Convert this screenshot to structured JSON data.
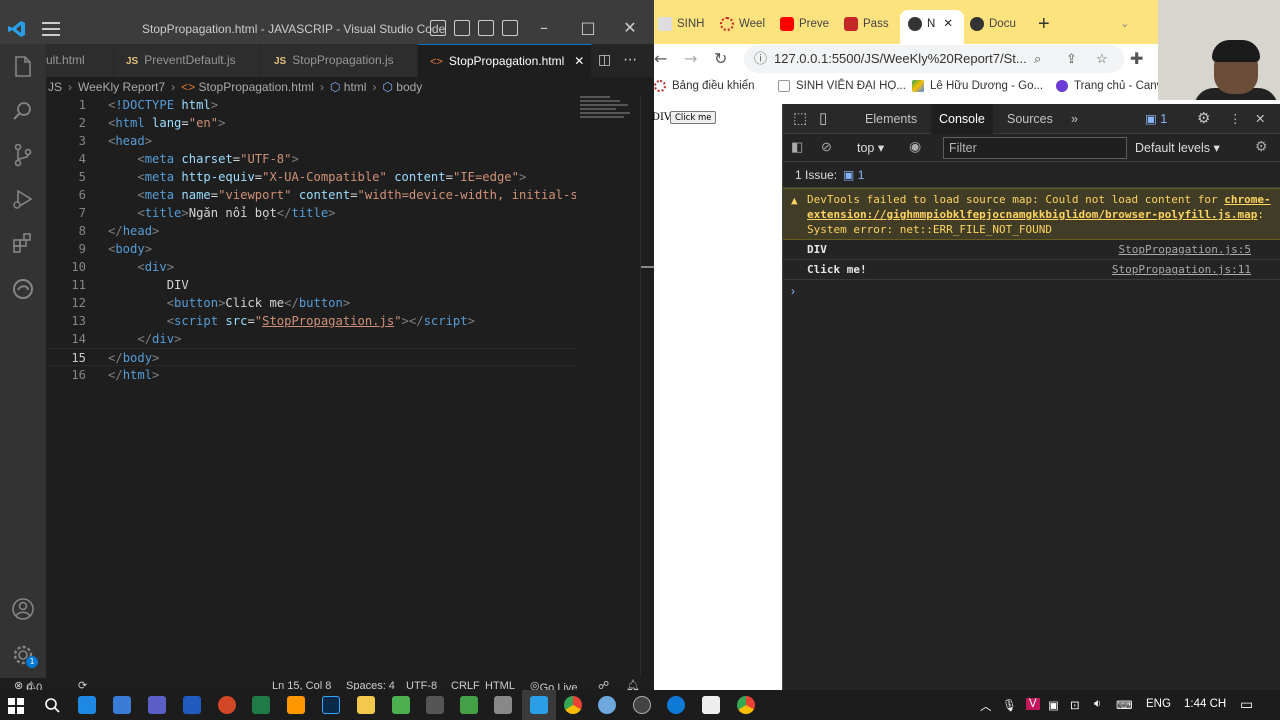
{
  "vscode": {
    "title": "StopPropagation.html - JAVASCRIP - Visual Studio Code",
    "tabs": [
      {
        "label": "ult.html",
        "type": "html"
      },
      {
        "label": "PreventDefault.js",
        "type": "js"
      },
      {
        "label": "StopPropagation.js",
        "type": "js"
      },
      {
        "label": "StopPropagation.html",
        "type": "html",
        "active": true
      }
    ],
    "breadcrumb": [
      "JS",
      "WeeKly Report7",
      "StopPropagation.html",
      "html",
      "body"
    ],
    "code_lines": [
      {
        "n": "1"
      },
      {
        "n": "2"
      },
      {
        "n": "3"
      },
      {
        "n": "4"
      },
      {
        "n": "5"
      },
      {
        "n": "6"
      },
      {
        "n": "7"
      },
      {
        "n": "8"
      },
      {
        "n": "9"
      },
      {
        "n": "10"
      },
      {
        "n": "11"
      },
      {
        "n": "12"
      },
      {
        "n": "13"
      },
      {
        "n": "14"
      },
      {
        "n": "15"
      },
      {
        "n": "16"
      }
    ],
    "code": {
      "doctype": "!DOCTYPE",
      "doctype_val": "html",
      "html_tag": "html",
      "lang_attr": "lang",
      "lang_val": "\"en\"",
      "head_tag": "head",
      "meta_tag": "meta",
      "charset_attr": "charset",
      "charset_val": "\"UTF-8\"",
      "httpequiv_attr": "http-equiv",
      "httpequiv_val": "\"X-UA-Compatible\"",
      "content_attr": "content",
      "content_val": "\"IE=edge\"",
      "name_attr": "name",
      "name_val": "\"viewport\"",
      "content_val2": "\"width=device-width, initial-sc",
      "title_tag": "title",
      "title_text": "Ngăn nổi bọt",
      "body_tag": "body",
      "div_tag": "div",
      "div_text": "DIV",
      "button_tag": "button",
      "button_text": "Click me",
      "script_tag": "script",
      "src_attr": "src",
      "src_val": "StopPropagation.js"
    },
    "status": {
      "errors": "0",
      "warnings": "0",
      "position": "Ln 15, Col 8",
      "spaces": "Spaces: 4",
      "encoding": "UTF-8",
      "eol": "CRLF",
      "language": "HTML",
      "golive": "Go Live"
    },
    "accounts_badge": "1"
  },
  "chrome": {
    "tabs": [
      "SINH",
      "Weel",
      "Preve",
      "Pass",
      "N",
      "Docu"
    ],
    "url": "127.0.0.1:5500/JS/WeeKly%20Report7/St...",
    "bookmarks": [
      "Bảng điều khiển",
      "SINH VIÊN ĐẠI HỌ...",
      "Lê Hữu Dương - Go...",
      "Trang chủ - Canv"
    ],
    "page": {
      "div_text": "DIV",
      "button_text": "Click me"
    },
    "devtools": {
      "tabs": [
        "Elements",
        "Console",
        "Sources"
      ],
      "issues_count": "1",
      "context": "top",
      "filter_placeholder": "Filter",
      "levels": "Default levels",
      "issues_label": "1 Issue:",
      "warning_prefix": "DevTools failed to load source map: Could not load content for ",
      "warning_link": "chrome-extension://gighmmpiobklfepjocnamgkkbiglidom/browser-polyfill.js.map",
      "warning_suffix": ": System error: net::ERR_FILE_NOT_FOUND",
      "logs": [
        {
          "msg": "DIV",
          "src": "StopPropagation.js:5"
        },
        {
          "msg": "Click me!",
          "src": "StopPropagation.js:11"
        }
      ],
      "prompt": "›"
    }
  },
  "taskbar": {
    "lang": "ENG",
    "time": "1:44 CH"
  }
}
